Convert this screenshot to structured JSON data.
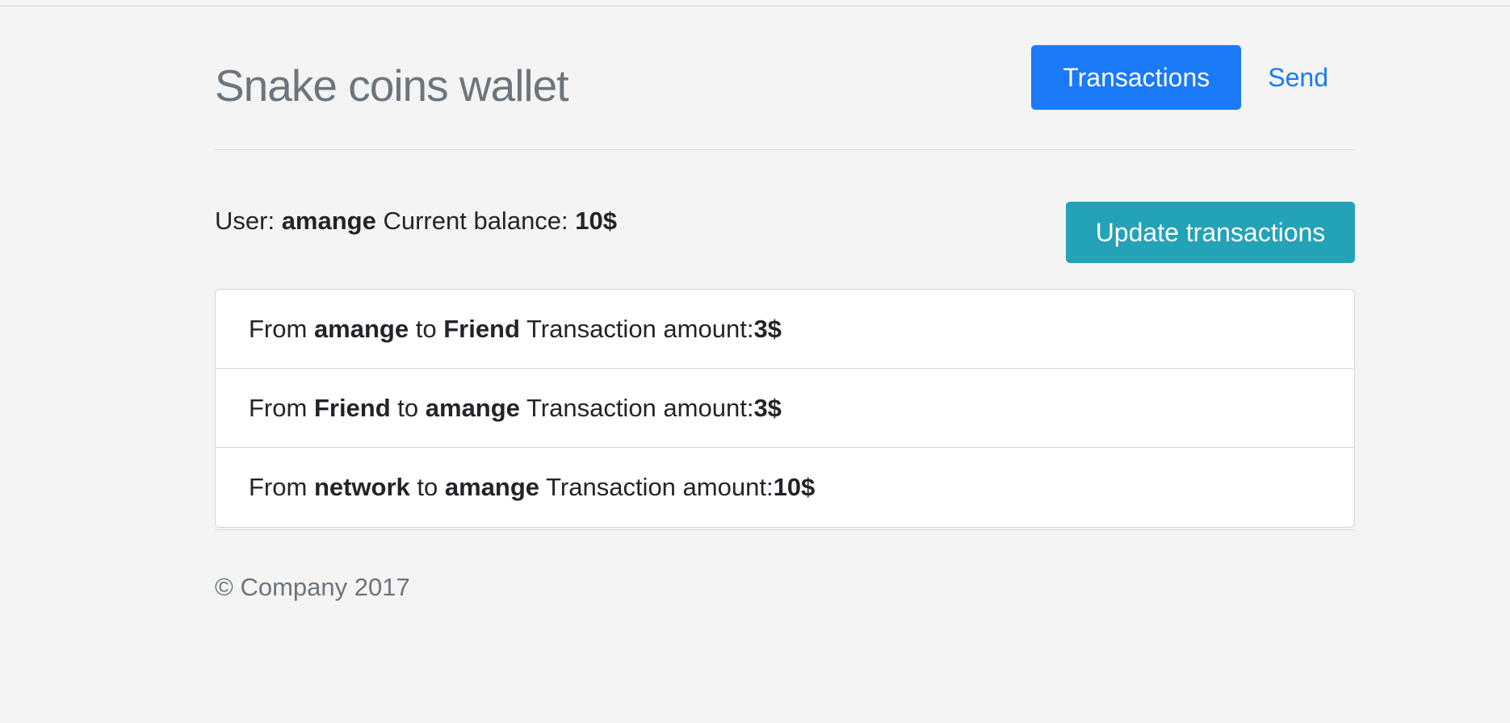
{
  "app": {
    "title": "Snake coins wallet"
  },
  "nav": {
    "transactions_label": "Transactions",
    "send_label": "Send"
  },
  "account": {
    "user_prefix": "User: ",
    "username": "amange",
    "balance_prefix": " Current balance: ",
    "balance": "10$"
  },
  "actions": {
    "update_label": "Update transactions"
  },
  "transactions": [
    {
      "from_word": "From ",
      "from": "amange",
      "to_word": " to ",
      "to": "Friend",
      "amount_label": " Transaction amount:",
      "amount": "3$"
    },
    {
      "from_word": "From ",
      "from": "Friend",
      "to_word": " to ",
      "to": "amange",
      "amount_label": " Transaction amount:",
      "amount": "3$"
    },
    {
      "from_word": "From ",
      "from": "network",
      "to_word": " to ",
      "to": "amange",
      "amount_label": " Transaction amount:",
      "amount": "10$"
    }
  ],
  "footer": {
    "copyright": "© Company 2017"
  },
  "colors": {
    "primary": "#1a7af8",
    "info": "#24a2b8",
    "muted": "#6c757d",
    "background": "#f4f4f4"
  }
}
